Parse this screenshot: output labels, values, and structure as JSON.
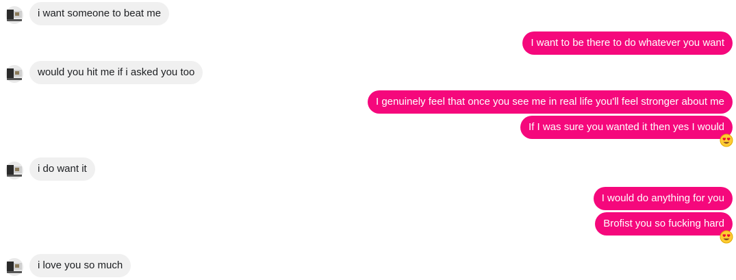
{
  "conversation": {
    "messages": [
      {
        "direction": "incoming",
        "text": "i want someone to beat me"
      },
      {
        "direction": "outgoing",
        "text": "I want to be there to do whatever you want"
      },
      {
        "direction": "incoming",
        "text": "would you hit me if i asked you too"
      },
      {
        "direction": "outgoing",
        "text": "I genuinely feel that once you see me in real life you'll feel stronger about me"
      },
      {
        "direction": "outgoing",
        "text": "If I was sure you wanted it then yes I would",
        "reaction": "heart-eyes-emoji"
      },
      {
        "direction": "incoming",
        "text": "i do want it"
      },
      {
        "direction": "outgoing",
        "text": "I would do anything for you"
      },
      {
        "direction": "outgoing",
        "text": "Brofist you so fucking hard",
        "reaction": "heart-eyes-emoji"
      },
      {
        "direction": "incoming",
        "text": "i love you so much"
      }
    ]
  },
  "colors": {
    "outgoing_bubble": "#f5087c",
    "incoming_bubble": "#f0f0f0"
  }
}
